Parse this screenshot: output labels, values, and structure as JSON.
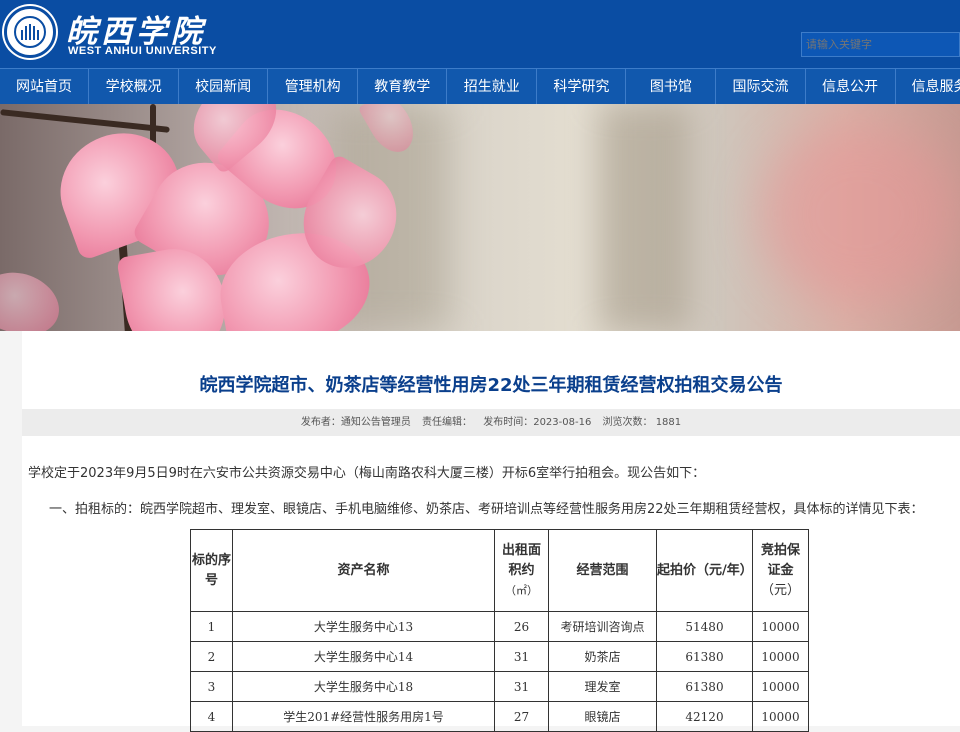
{
  "header": {
    "logo_cn": "皖西学院",
    "logo_en": "WEST ANHUI UNIVERSITY",
    "search_placeholder": "请输入关键字"
  },
  "nav": [
    {
      "label": "网站首页"
    },
    {
      "label": "学校概况"
    },
    {
      "label": "校园新闻"
    },
    {
      "label": "管理机构"
    },
    {
      "label": "教育教学"
    },
    {
      "label": "招生就业"
    },
    {
      "label": "科学研究"
    },
    {
      "label": "图书馆"
    },
    {
      "label": "国际交流"
    },
    {
      "label": "信息公开"
    },
    {
      "label": "信息服务"
    }
  ],
  "article": {
    "title": "皖西学院超市、奶茶店等经营性用房22处三年期租赁经营权拍租交易公告",
    "meta": {
      "publisher": "发布者：通知公告管理员",
      "editor": "责任编辑：",
      "date": "发布时间：2023-08-16",
      "views": "浏览次数： 1881"
    },
    "para1": "学校定于2023年9月5日9时在六安市公共资源交易中心（梅山南路农科大厦三楼）开标6室举行拍租会。现公告如下：",
    "para2": "一、拍租标的：皖西学院超市、理发室、眼镜店、手机电脑维修、奶茶店、考研培训点等经营性服务用房22处三年期租赁经营权，具体标的详情见下表：",
    "table": {
      "headers": {
        "seq": "标的序号",
        "name": "资产名称",
        "area_line1": "出租面",
        "area_line2": "积约",
        "area_unit": "（㎡）",
        "scope": "经营范围",
        "price": "起拍价（元/年）",
        "deposit_line1": "竞拍保",
        "deposit_line2": "证金",
        "deposit_unit": "（元）"
      },
      "rows": [
        {
          "seq": "1",
          "name": "大学生服务中心13",
          "area": "26",
          "scope": "考研培训咨询点",
          "price": "51480",
          "deposit": "10000"
        },
        {
          "seq": "2",
          "name": "大学生服务中心14",
          "area": "31",
          "scope": "奶茶店",
          "price": "61380",
          "deposit": "10000"
        },
        {
          "seq": "3",
          "name": "大学生服务中心18",
          "area": "31",
          "scope": "理发室",
          "price": "61380",
          "deposit": "10000"
        },
        {
          "seq": "4",
          "name": "学生201#经营性服务用房1号",
          "area": "27",
          "scope": "眼镜店",
          "price": "42120",
          "deposit": "10000"
        }
      ]
    }
  }
}
